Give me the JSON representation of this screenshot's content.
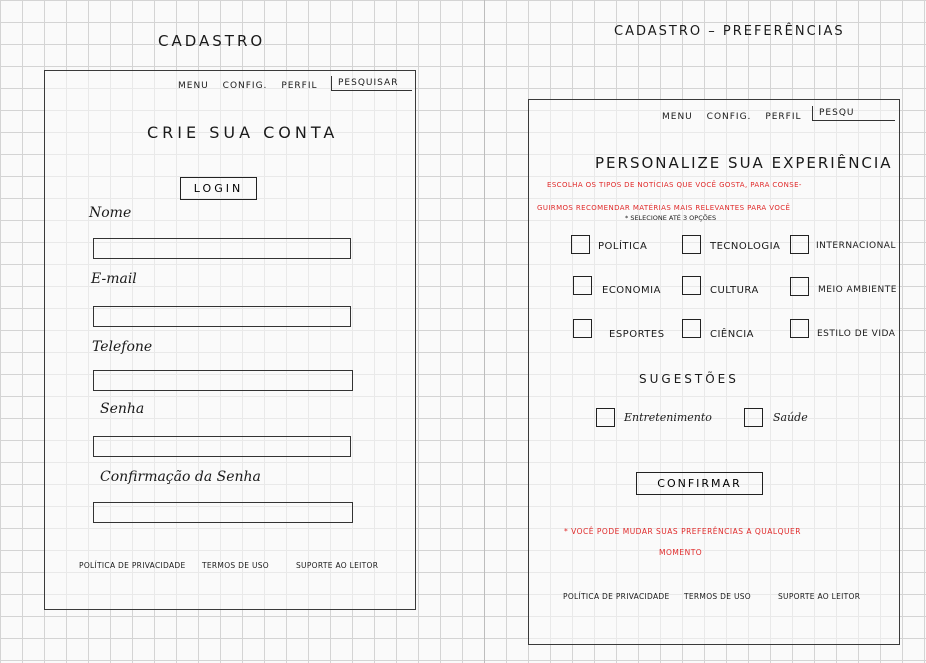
{
  "left": {
    "title": "CADASTRO",
    "nav": {
      "menu": "MENU",
      "config": "CONFIG.",
      "perfil": "PERFIL",
      "search": "PESQUISAR"
    },
    "heading": "CRIE SUA CONTA",
    "login_label": "LOGIN",
    "fields": [
      {
        "label": "Nome",
        "value": ""
      },
      {
        "label": "E-mail",
        "value": ""
      },
      {
        "label": "Telefone",
        "value": ""
      },
      {
        "label": "Senha",
        "value": ""
      },
      {
        "label": "Confirmação da Senha",
        "value": ""
      }
    ],
    "footer": {
      "privacy": "POLÍTICA DE PRIVACIDADE",
      "terms": "TERMOS DE USO",
      "support": "SUPORTE AO LEITOR"
    }
  },
  "right": {
    "title": "CADASTRO – PREFERÊNCIAS",
    "nav": {
      "menu": "MENU",
      "config": "CONFIG.",
      "perfil": "PERFIL",
      "search": "PESQU"
    },
    "heading": "PERSONALIZE SUA EXPERIÊNCIA",
    "intro_line1": "ESCOLHA OS TIPOS DE NOTÍCIAS QUE VOCÊ GOSTA, PARA CONSE-",
    "intro_line2": "GUIRMOS RECOMENDAR MATÉRIAS MAIS RELEVANTES PARA VOCÊ",
    "limit_note": "* SELECIONE ATÉ 3 OPÇÕES",
    "categories": [
      {
        "label": "Política",
        "checked": false
      },
      {
        "label": "Tecnologia",
        "checked": false
      },
      {
        "label": "Internacional",
        "checked": false
      },
      {
        "label": "Economia",
        "checked": false
      },
      {
        "label": "Cultura",
        "checked": false
      },
      {
        "label": "Meio Ambiente",
        "checked": false
      },
      {
        "label": "Esportes",
        "checked": false
      },
      {
        "label": "Ciência",
        "checked": false
      },
      {
        "label": "Estilo de Vida",
        "checked": false
      }
    ],
    "suggestions_title": "SUGESTÕES",
    "suggestions": [
      {
        "label": "Entretenimento",
        "checked": false
      },
      {
        "label": "Saúde",
        "checked": false
      }
    ],
    "confirm_label": "CONFIRMAR",
    "footnote_line1": "* VOCÊ PODE MUDAR SUAS PREFERÊNCIAS A QUALQUER",
    "footnote_line2": "MOMENTO",
    "footer": {
      "privacy": "POLÍTICA DE PRIVACIDADE",
      "terms": "TERMOS DE USO",
      "support": "SUPORTE AO LEITOR"
    }
  }
}
